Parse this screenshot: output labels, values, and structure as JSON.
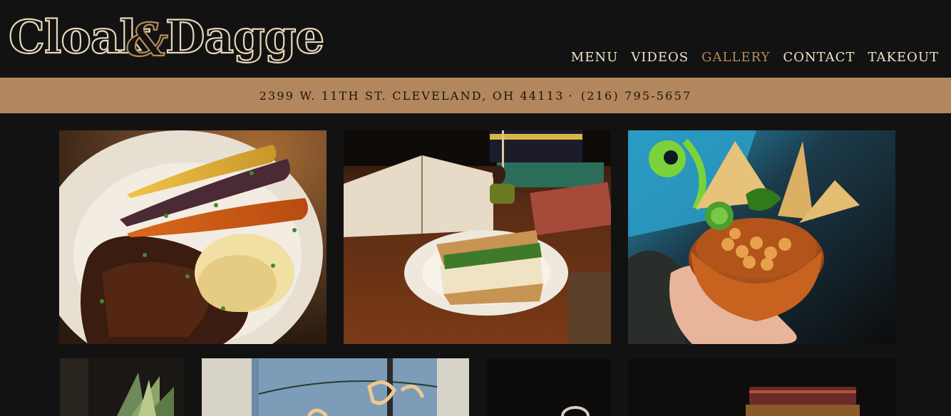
{
  "logo": {
    "part1": "Cloak",
    "amp": "&",
    "part2": "Dagger"
  },
  "nav": {
    "items": [
      {
        "label": "MENU",
        "active": false
      },
      {
        "label": "VIDEOS",
        "active": false
      },
      {
        "label": "GALLERY",
        "active": true
      },
      {
        "label": "CONTACT",
        "active": false
      },
      {
        "label": "TAKEOUT",
        "active": false
      }
    ]
  },
  "address": {
    "street": "2399 W. 11TH ST. CLEVELAND, OH 44113",
    "separator": "·",
    "phone": "(216) 795-5657"
  },
  "colors": {
    "background": "#121212",
    "cream": "#efe3c8",
    "accent": "#b58a5a",
    "addressbar": "#b2875d"
  },
  "gallery": {
    "photos": [
      {
        "subject": "carrots-steak-mash-photo"
      },
      {
        "subject": "sandwich-books-photo"
      },
      {
        "subject": "chickpea-bowl-chips-photo"
      },
      {
        "subject": "pineapple-photo"
      },
      {
        "subject": "storefront-sign-photo"
      },
      {
        "subject": "dark-mirror-photo"
      },
      {
        "subject": "books-stack-photo"
      }
    ]
  }
}
